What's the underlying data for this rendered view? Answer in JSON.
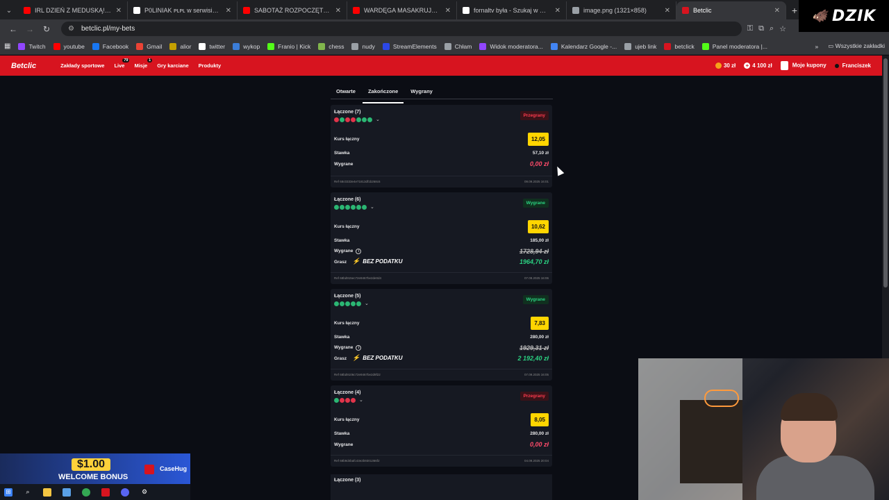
{
  "browser": {
    "tabs": [
      {
        "title": "IRL DZIEŃ Z MEDUSKĄ! 2/30 | Y",
        "icon": "youtube-icon",
        "color": "#ff0000"
      },
      {
        "title": "P0LINIAK ᴘʟᴘʟ w serwisie X: „Dzi",
        "icon": "x-icon",
        "color": "#ffffff"
      },
      {
        "title": "SABOTAŻ ROZPOCZĘTY! SABO",
        "icon": "youtube-icon",
        "color": "#ff0000"
      },
      {
        "title": "WARDĘGA MASAKRUJE \"NIE W",
        "icon": "youtube-icon",
        "color": "#ff0000"
      },
      {
        "title": "fornaltv była - Szukaj w Google",
        "icon": "google-icon",
        "color": "#ffffff"
      },
      {
        "title": "image.png (1321×858)",
        "icon": "globe-icon",
        "color": "#9aa0a6"
      },
      {
        "title": "Betclic",
        "icon": "betclic-icon",
        "color": "#d7141f"
      }
    ],
    "url": "betclic.pl/my-bets",
    "bookmarks": [
      {
        "label": "Twitch",
        "color": "#9146ff"
      },
      {
        "label": "youtube",
        "color": "#ff0000"
      },
      {
        "label": "Facebook",
        "color": "#1877f2"
      },
      {
        "label": "Gmail",
        "color": "#ea4335"
      },
      {
        "label": "alior",
        "color": "#c4a000"
      },
      {
        "label": "twitter",
        "color": "#ffffff"
      },
      {
        "label": "wykop",
        "color": "#3b7dd8"
      },
      {
        "label": "Franio | Kick",
        "color": "#53fc18"
      },
      {
        "label": "chess",
        "color": "#81b64c"
      },
      {
        "label": "nudy",
        "color": "#9aa0a6"
      },
      {
        "label": "StreamElements",
        "color": "#2b47e6"
      },
      {
        "label": "Chłam",
        "color": "#9aa0a6"
      },
      {
        "label": "Widok moderatora...",
        "color": "#9146ff"
      },
      {
        "label": "Kalendarz Google -...",
        "color": "#4285f4"
      },
      {
        "label": "ujeb link",
        "color": "#9aa0a6"
      },
      {
        "label": "betclick",
        "color": "#d7141f"
      },
      {
        "label": "Panel moderatora |...",
        "color": "#53fc18"
      }
    ],
    "all_bookmarks": "Wszystkie zakładki"
  },
  "overlay": {
    "dzik": "DZIK",
    "promo_amount": "$1.00",
    "promo_text": "WELCOME BONUS",
    "promo_brand": "CaseHug"
  },
  "site": {
    "logo": "Betclic",
    "nav": [
      "Zakłady sportowe",
      "Live",
      "Misje",
      "Gry karciane",
      "Produkty"
    ],
    "live_badge": "79",
    "misje_badge": "1",
    "coins": "30 zł",
    "balance": "4 100 zł",
    "my_coupons": "Moje kupony",
    "user": "Franciszek",
    "tabs": [
      "Otwarte",
      "Zakończone",
      "Wygrany"
    ]
  },
  "bets": [
    {
      "title": "Łączone (7)",
      "status": "Przegrany",
      "won": false,
      "dots": [
        "r",
        "g",
        "r",
        "r",
        "g",
        "g",
        "g"
      ],
      "odds_label": "Kurs łączny",
      "odds": "12,05",
      "stake_label": "Stawka",
      "stake": "57,10 zł",
      "win_label": "Wygrane",
      "win": "0,00 zł",
      "ref": "Ref 68c0333e4e71813df1b268c6",
      "date": "09.09.2025 16:01"
    },
    {
      "title": "Łączone (6)",
      "status": "Wygrane",
      "won": true,
      "dots": [
        "g",
        "g",
        "g",
        "g",
        "g",
        "g"
      ],
      "odds_label": "Kurs łączny",
      "odds": "10,62",
      "stake_label": "Stawka",
      "stake": "185,00 zł",
      "win_label": "Wygrane",
      "win_old": "1728,94 zł",
      "gram_label": "Grasz",
      "bez": "BEZ PODATKU",
      "win": "1964,70 zł",
      "ref": "Ref 68bd915ec72e9467be2de0d4",
      "date": "07.09.2025 16:06"
    },
    {
      "title": "Łączone (5)",
      "status": "Wygrane",
      "won": true,
      "dots": [
        "g",
        "g",
        "g",
        "g",
        "g"
      ],
      "odds_label": "Kurs łączny",
      "odds": "7,83",
      "stake_label": "Stawka",
      "stake": "280,00 zł",
      "win_label": "Wygrane",
      "win_old": "1929,31 zł",
      "gram_label": "Grasz",
      "bez": "BEZ PODATKU",
      "win": "2 192,40 zł",
      "ref": "Ref 68bd9106c72e9467be2d9f22",
      "date": "07.09.2025 16:05"
    },
    {
      "title": "Łączone (4)",
      "status": "Przegrany",
      "won": false,
      "dots": [
        "g",
        "r",
        "r",
        "r"
      ],
      "odds_label": "Kurs łączny",
      "odds": "8,05",
      "stake_label": "Stawka",
      "stake": "280,00 zł",
      "win_label": "Wygrane",
      "win": "0,00 zł",
      "ref": "Ref 68b9d4bafc43e2b9301366f2",
      "date": "04.09.2025 20:04"
    }
  ],
  "next_bet_title": "Łączone (3)"
}
